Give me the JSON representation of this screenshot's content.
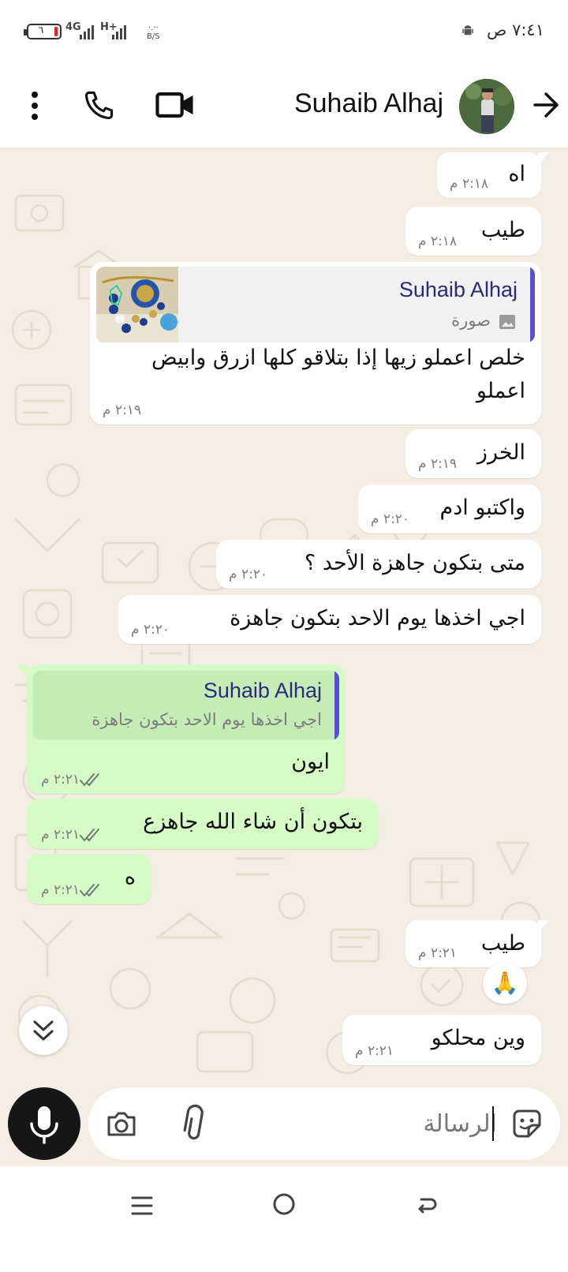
{
  "status_bar": {
    "battery": "٦",
    "network_1": "4G",
    "network_2": "H+",
    "speed": "·.··",
    "speed_unit": "B/S",
    "time": "٧:٤١ ص"
  },
  "header": {
    "contact_name": "Suhaib Alhaj",
    "icons": [
      "back-arrow-icon",
      "avatar",
      "video-call-icon",
      "phone-icon",
      "more-options-icon"
    ]
  },
  "messages": [
    {
      "dir": "in",
      "text": "اه",
      "time": "٢:١٨ م"
    },
    {
      "dir": "in",
      "text": "طيب",
      "time": "٢:١٨ م"
    },
    {
      "dir": "in",
      "reply_name": "Suhaib Alhaj",
      "reply_text": "صورة",
      "text_line1": "خلص اعملو زيها إذا بتلاقو كلها ازرق وابيض",
      "text_line2": "اعملو",
      "time": "٢:١٩ م"
    },
    {
      "dir": "in",
      "text": "الخرز",
      "time": "٢:١٩ م"
    },
    {
      "dir": "in",
      "text": "واكتبو ادم",
      "time": "٢:٢٠ م"
    },
    {
      "dir": "in",
      "text": "متى بتكون جاهزة الأحد ؟",
      "time": "٢:٢٠ م"
    },
    {
      "dir": "in",
      "text": "اجي اخذها يوم الاحد بتكون جاهزة",
      "time": "٢:٢٠ م"
    },
    {
      "dir": "out",
      "reply_name": "Suhaib Alhaj",
      "reply_text": "اجي اخذها يوم الاحد بتكون جاهزة",
      "text": "ايون",
      "time": "٢:٢١ م"
    },
    {
      "dir": "out",
      "text": "بتكون أن شاء الله جاهزع",
      "time": "٢:٢١ م"
    },
    {
      "dir": "out",
      "text": "ه",
      "time": "٢:٢١ م"
    },
    {
      "dir": "in",
      "text": "طيب",
      "time": "٢:٢١ م",
      "reaction": "🙏"
    },
    {
      "dir": "in",
      "text": "وين محلكو",
      "time": "٢:٢١ م"
    }
  ],
  "composer": {
    "placeholder": "الرسالة"
  },
  "colors": {
    "chat_bg": "#f3ede3",
    "outgoing_bubble": "#d7fbc7",
    "incoming_bubble": "#ffffff",
    "quote_bar": "#5b4fd6",
    "quote_name": "#2b2a7c",
    "mic_button": "#161616"
  }
}
